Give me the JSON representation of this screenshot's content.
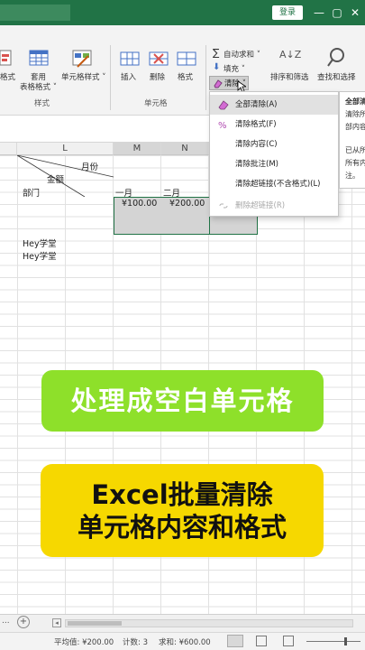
{
  "titlebar": {
    "login_label": "登录",
    "minimize": "—",
    "restore": "▢",
    "close": "✕"
  },
  "ribbon": {
    "cell_styles_partial": "格式",
    "table_format_label": "套用\n表格格式",
    "table_format_line1": "套用",
    "table_format_line2": "表格格式 ˅",
    "cell_style_label": "单元格样式 ˅",
    "styles_group": "样式",
    "insert_label": "插入",
    "delete_label": "删除",
    "format_label": "格式",
    "cells_group": "单元格",
    "autosum_label": "自动求和 ˅",
    "fill_label": "填充 ˅",
    "clear_label": "清除 ˅",
    "sort_filter_label": "排序和筛选",
    "find_select_label": "查找和选择",
    "sort_icon_text": "A↓Z"
  },
  "columns": [
    {
      "label": "L"
    },
    {
      "label": "M"
    },
    {
      "label": "N"
    }
  ],
  "sheet": {
    "header_month": "月份",
    "header_amount": "金额",
    "header_dept": "部门",
    "month_1": "一月",
    "month_2": "二月",
    "value_1": "¥100.00",
    "value_2": "¥200.00",
    "row_a": "Hey学堂",
    "row_b": "Hey学堂"
  },
  "menu": {
    "items": [
      {
        "label": "全部清除(A)",
        "icon": "eraser-icon",
        "highlighted": true,
        "disabled": false
      },
      {
        "label": "清除格式(F)",
        "icon": "clear-format-icon",
        "highlighted": false,
        "disabled": false
      },
      {
        "label": "清除内容(C)",
        "icon": "",
        "highlighted": false,
        "disabled": false
      },
      {
        "label": "清除批注(M)",
        "icon": "",
        "highlighted": false,
        "disabled": false
      },
      {
        "label": "清除超链接(不含格式)(L)",
        "icon": "",
        "highlighted": false,
        "disabled": false
      },
      {
        "label": "删除超链接(R)",
        "icon": "unlink-icon",
        "highlighted": false,
        "disabled": true
      }
    ]
  },
  "tooltip": {
    "line1": "全部清",
    "line2": "清除所",
    "line3": "部内容",
    "line4": "已从所",
    "line5": "所有内",
    "line6": "注。"
  },
  "banners": {
    "green": "处理成空白单元格",
    "yellow_line1": "Excel批量清除",
    "yellow_line2": "单元格内容和格式"
  },
  "tabs": {
    "nav_more": "...",
    "add": "+"
  },
  "status": {
    "average": "平均值: ¥200.00",
    "count": "计数: 3",
    "sum": "求和: ¥600.00"
  },
  "colors": {
    "excel_green": "#217346",
    "banner_green": "#8ee02a",
    "banner_yellow": "#f6d800",
    "selection_gray": "#d4d4d4"
  }
}
